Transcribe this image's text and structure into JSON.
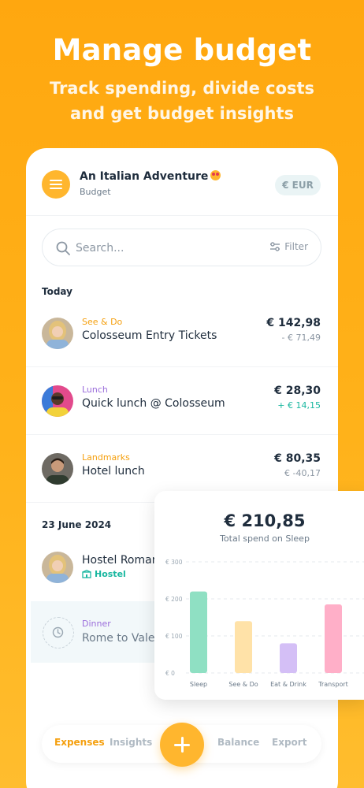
{
  "hero": {
    "title": "Manage budget",
    "subtitle_line1": "Track spending, divide costs",
    "subtitle_line2": "and get budget insights"
  },
  "header": {
    "trip_title": "An Italian Adventure",
    "trip_subtitle": "Budget",
    "currency": "€ EUR"
  },
  "search": {
    "placeholder": "Search...",
    "filter_label": "Filter"
  },
  "sections": {
    "today": "Today",
    "june": "23 June 2024"
  },
  "expenses": [
    {
      "category": "See & Do",
      "title": "Colosseum Entry Tickets",
      "amount": "€ 142,98",
      "split": "- € 71,49"
    },
    {
      "category": "Lunch",
      "title": "Quick lunch @ Colosseum",
      "amount": "€ 28,30",
      "split": "+ € 14,15"
    },
    {
      "category": "Landmarks",
      "title": "Hotel lunch",
      "amount": "€ 80,35",
      "split": "€ -40,17"
    },
    {
      "category": "",
      "title": "Hostel Romana",
      "tag": "Hostel"
    },
    {
      "category": "Dinner",
      "title": "Rome to Valen"
    }
  ],
  "nav": {
    "expenses": "Expenses",
    "insights": "Insights",
    "balance": "Balance",
    "export": "Export"
  },
  "insight": {
    "total": "€ 210,85",
    "subtitle": "Total spend on Sleep"
  },
  "chart_data": {
    "type": "bar",
    "categories": [
      "Sleep",
      "See & Do",
      "Eat & Drink",
      "Transport"
    ],
    "values": [
      220,
      140,
      80,
      185
    ],
    "colors": [
      "#8FE0C3",
      "#FFE2A8",
      "#D4BFF6",
      "#FFAFC8"
    ],
    "ylim": [
      0,
      300
    ],
    "yticks": [
      0,
      100,
      200,
      300
    ],
    "ytick_labels": [
      "€ 0",
      "€ 100",
      "€ 200",
      "€ 300"
    ],
    "grid": true
  }
}
